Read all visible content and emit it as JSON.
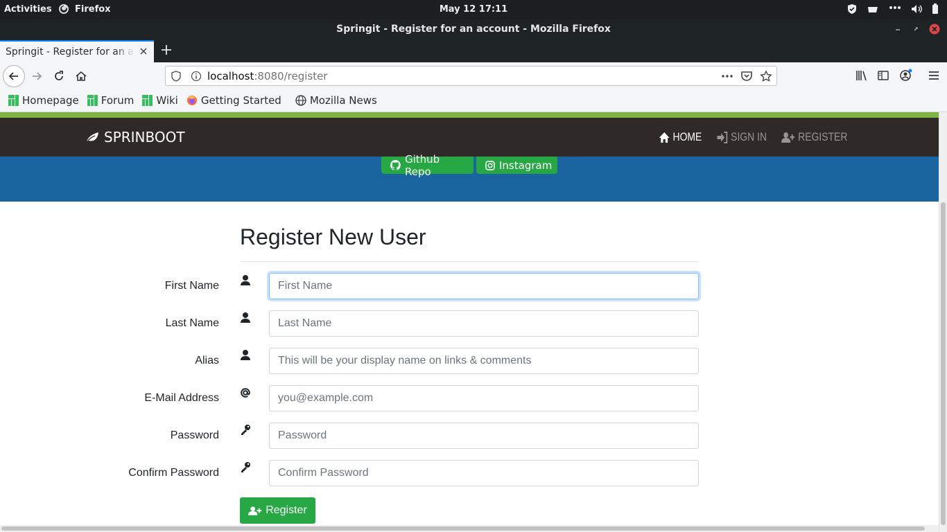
{
  "system": {
    "activities": "Activities",
    "app_name": "Firefox",
    "clock": "May 12  17:11"
  },
  "window": {
    "title": "Springit - Register for an account - Mozilla Firefox"
  },
  "tab": {
    "title": "Springit - Register for an account"
  },
  "urlbar": {
    "host": "localhost",
    "rest": ":8080/register"
  },
  "bookmarks": [
    {
      "label": "Homepage",
      "icon": "manjaro-icon"
    },
    {
      "label": "Forum",
      "icon": "manjaro-icon"
    },
    {
      "label": "Wiki",
      "icon": "manjaro-icon"
    },
    {
      "label": "Getting Started",
      "icon": "firefox-icon"
    },
    {
      "label": "Mozilla News",
      "icon": "globe-icon"
    }
  ],
  "site": {
    "brand": "SPRINBOOT",
    "nav": {
      "home": "HOME",
      "signin": "SIGN IN",
      "register": "REGISTER"
    },
    "hero_buttons": {
      "github": "Github Repo",
      "instagram": "Instagram"
    }
  },
  "form": {
    "title": "Register New User",
    "fields": {
      "first_name": {
        "label": "First Name",
        "placeholder": "First Name",
        "icon": "user-icon"
      },
      "last_name": {
        "label": "Last Name",
        "placeholder": "Last Name",
        "icon": "user-icon"
      },
      "alias": {
        "label": "Alias",
        "placeholder": "This will be your display name on links & comments",
        "icon": "user-icon"
      },
      "email": {
        "label": "E-Mail Address",
        "placeholder": "you@example.com",
        "icon": "at-icon"
      },
      "password": {
        "label": "Password",
        "placeholder": "Password",
        "icon": "key-icon"
      },
      "confirm_password": {
        "label": "Confirm Password",
        "placeholder": "Confirm Password",
        "icon": "key-icon"
      }
    },
    "submit": "Register"
  },
  "colors": {
    "accent_green": "#28a745",
    "hero_blue": "#1a64a0",
    "navbar_dark": "#2f2a27",
    "top_strip": "#7cb342"
  }
}
